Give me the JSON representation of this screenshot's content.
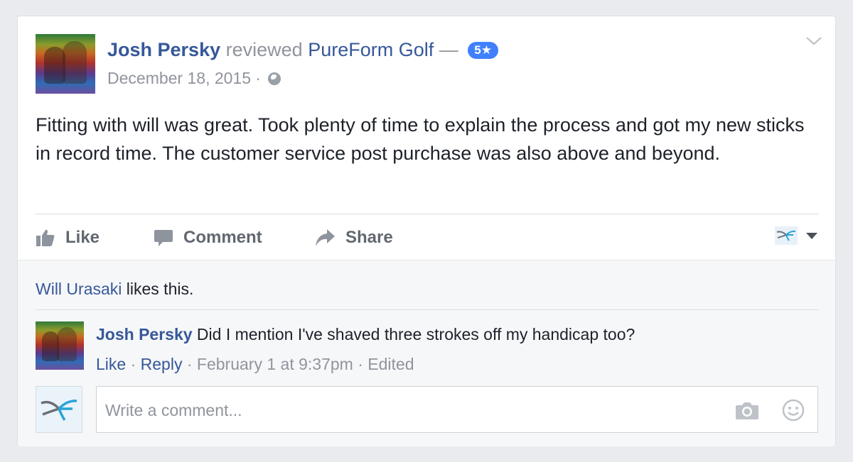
{
  "post": {
    "author": "Josh Persky",
    "verb": "reviewed",
    "page_name": "PureForm Golf",
    "dash": "—",
    "rating_badge": "5★",
    "date": "December 18, 2015",
    "meta_sep": "·",
    "privacy_icon": "globe-icon",
    "body": "Fitting with will was great. Took plenty of time to explain the process and got my new sticks in record time. The customer service post purchase was also above and beyond."
  },
  "actions": {
    "like": "Like",
    "comment": "Comment",
    "share": "Share"
  },
  "likes": {
    "name": "Will Urasaki",
    "suffix": " likes this."
  },
  "comment": {
    "author": "Josh Persky",
    "text": "Did I mention I've shaved three strokes off my handicap too?",
    "like": "Like",
    "reply": "Reply",
    "time": "February 1 at 9:37pm",
    "edited": "Edited",
    "sep": "·"
  },
  "composer": {
    "placeholder": "Write a comment..."
  },
  "colors": {
    "link": "#365899",
    "badge": "#4080ff",
    "muted": "#90949c",
    "background": "#e9ebee"
  }
}
